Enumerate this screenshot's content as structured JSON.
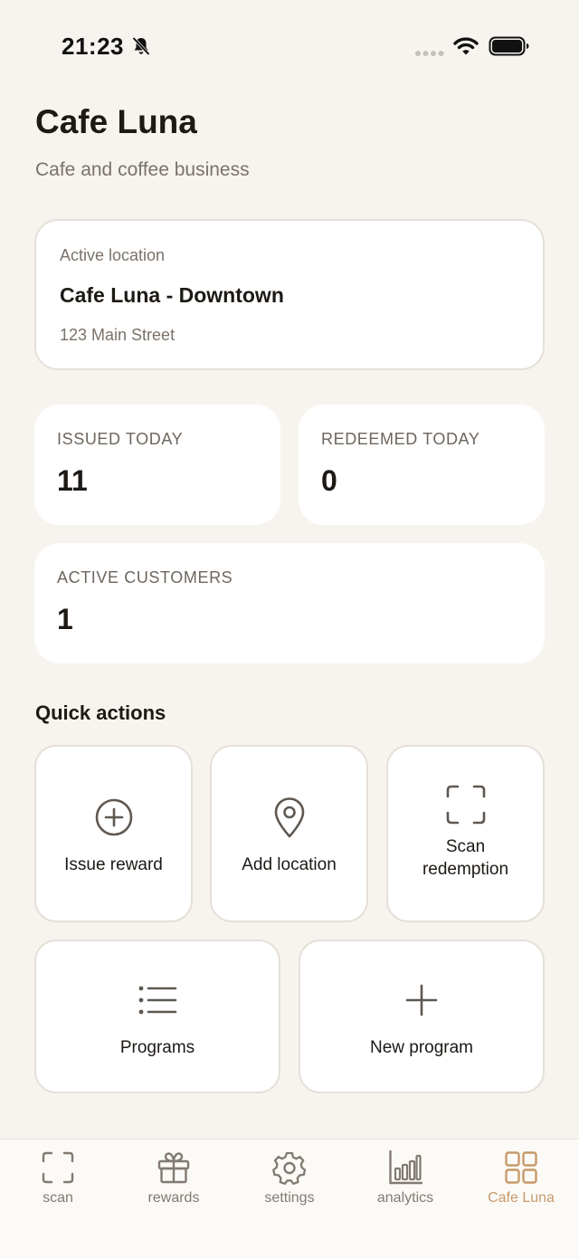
{
  "status_bar": {
    "time": "21:23"
  },
  "header": {
    "title": "Cafe Luna",
    "subtitle": "Cafe and coffee business"
  },
  "location": {
    "label": "Active location",
    "name": "Cafe Luna - Downtown",
    "address": "123 Main Street"
  },
  "stats": {
    "issued": {
      "label": "ISSUED TODAY",
      "value": "11"
    },
    "redeemed": {
      "label": "REDEEMED TODAY",
      "value": "0"
    },
    "customers": {
      "label": "ACTIVE CUSTOMERS",
      "value": "1"
    }
  },
  "quick_actions": {
    "title": "Quick actions",
    "items": [
      {
        "label": "Issue reward",
        "icon": "plus-circle-icon"
      },
      {
        "label": "Add location",
        "icon": "map-pin-icon"
      },
      {
        "label": "Scan redemption",
        "icon": "scan-frame-icon"
      },
      {
        "label": "Programs",
        "icon": "list-icon"
      },
      {
        "label": "New program",
        "icon": "plus-icon"
      }
    ]
  },
  "tabs": [
    {
      "label": "scan",
      "icon": "scan-frame-icon"
    },
    {
      "label": "rewards",
      "icon": "gift-icon"
    },
    {
      "label": "settings",
      "icon": "gear-icon"
    },
    {
      "label": "analytics",
      "icon": "bar-chart-icon"
    },
    {
      "label": "Cafe Luna",
      "icon": "grid-icon",
      "active": true
    }
  ],
  "colors": {
    "background": "#f7f4ef",
    "card": "#ffffff",
    "accent": "#c89a6a",
    "icon": "#5f5851",
    "muted_text": "#7a726a"
  }
}
